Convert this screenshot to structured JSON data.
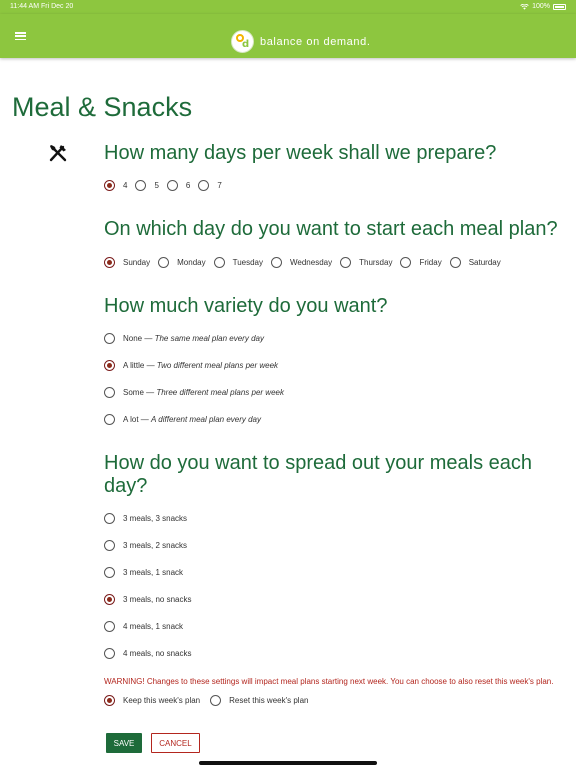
{
  "status_bar": {
    "time": "11:44 AM  Fri Dec 20",
    "battery": "100%",
    "icons": [
      "wifi-icon",
      "battery-icon"
    ]
  },
  "nav": {
    "brand": "balance on demand.",
    "icons": [
      "menu-icon",
      "logo-icon"
    ],
    "bar_color": "#8dc63f"
  },
  "page": {
    "title": "Meal & Snacks",
    "icon": "fork-knife-icon"
  },
  "questions": {
    "days": {
      "title": "How many days per week shall we prepare?",
      "options": [
        "4",
        "5",
        "6",
        "7"
      ],
      "selected": "4"
    },
    "start_day": {
      "title": "On which day do you want to start each meal plan?",
      "options": [
        "Sunday",
        "Monday",
        "Tuesday",
        "Wednesday",
        "Thursday",
        "Friday",
        "Saturday"
      ],
      "selected": "Sunday"
    },
    "variety": {
      "title": "How much variety do you want?",
      "options": [
        {
          "label": "None — ",
          "desc": "The same meal plan every day"
        },
        {
          "label": "A little — ",
          "desc": "Two different meal plans per week"
        },
        {
          "label": "Some — ",
          "desc": "Three different meal plans per week"
        },
        {
          "label": "A lot — ",
          "desc": "A different meal plan every day"
        }
      ],
      "selected_index": 1
    },
    "spread": {
      "title": "How do you want to spread out your meals each day?",
      "options": [
        "3 meals, 3 snacks",
        "3 meals, 2 snacks",
        "3 meals, 1 snack",
        "3 meals, no snacks",
        "4 meals, 1 snack",
        "4 meals, no snacks"
      ],
      "selected_index": 3
    }
  },
  "warning": "WARNING! Changes to these settings will impact meal plans starting next week. You can choose to also reset this week's plan.",
  "plan_choice": {
    "options": [
      "Keep this week's plan",
      "Reset this week's plan"
    ],
    "selected_index": 0
  },
  "buttons": {
    "save": "SAVE",
    "cancel": "CANCEL"
  },
  "colors": {
    "brand_green": "#8dc63f",
    "heading_green": "#1e6b3a",
    "warning_red": "#b3261e",
    "radio_selected": "#8b2a1a"
  }
}
